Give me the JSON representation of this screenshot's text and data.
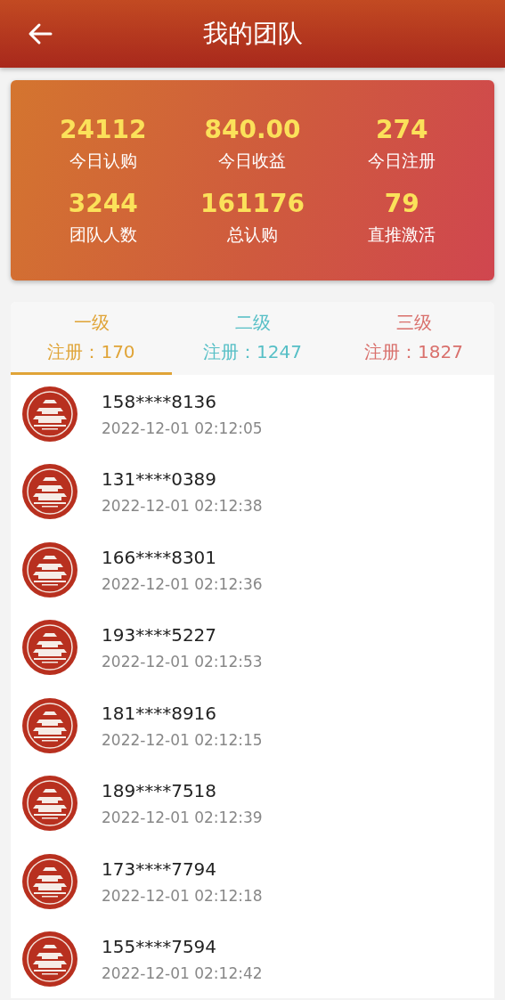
{
  "header": {
    "title": "我的团队"
  },
  "stats": [
    {
      "value": "24112",
      "label": "今日认购"
    },
    {
      "value": "840.00",
      "label": "今日收益"
    },
    {
      "value": "274",
      "label": "今日注册"
    },
    {
      "value": "3244",
      "label": "团队人数"
    },
    {
      "value": "161176",
      "label": "总认购"
    },
    {
      "value": "79",
      "label": "直推激活"
    }
  ],
  "tabs": [
    {
      "label": "一级",
      "count": "注册：170",
      "color": "#e0a437",
      "selected": true
    },
    {
      "label": "二级",
      "count": "注册：1247",
      "color": "#56bfc6",
      "selected": false
    },
    {
      "label": "三级",
      "count": "注册：1827",
      "color": "#d9706c",
      "selected": false
    }
  ],
  "members": [
    {
      "phone": "158****8136",
      "time": "2022-12-01 02:12:05"
    },
    {
      "phone": "131****0389",
      "time": "2022-12-01 02:12:38"
    },
    {
      "phone": "166****8301",
      "time": "2022-12-01 02:12:36"
    },
    {
      "phone": "193****5227",
      "time": "2022-12-01 02:12:53"
    },
    {
      "phone": "181****8916",
      "time": "2022-12-01 02:12:15"
    },
    {
      "phone": "189****7518",
      "time": "2022-12-01 02:12:39"
    },
    {
      "phone": "173****7794",
      "time": "2022-12-01 02:12:18"
    },
    {
      "phone": "155****7594",
      "time": "2022-12-01 02:12:42"
    }
  ]
}
